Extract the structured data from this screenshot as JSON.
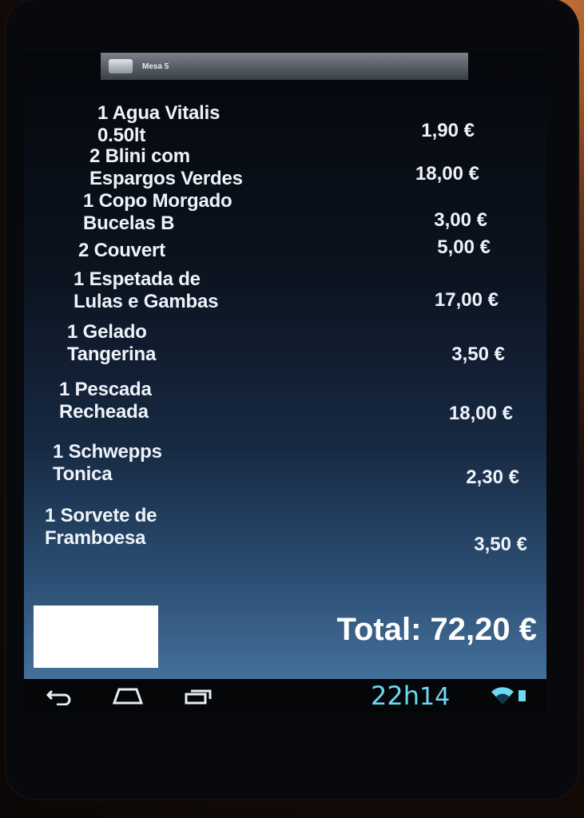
{
  "app": {
    "table_name": "Mesa 5"
  },
  "order_items": [
    {
      "name": "1 Agua Vitalis\n0.50lt",
      "price": "1,90 €"
    },
    {
      "name": "2 Blini com\nEspargos Verdes",
      "price": "18,00 €"
    },
    {
      "name": "1 Copo Morgado\nBucelas B",
      "price": "3,00 €"
    },
    {
      "name": "2 Couvert",
      "price": "5,00 €"
    },
    {
      "name": "1 Espetada de\nLulas e Gambas",
      "price": "17,00 €"
    },
    {
      "name": "1 Gelado\nTangerina",
      "price": "3,50 €"
    },
    {
      "name": "1 Pescada\nRecheada",
      "price": "18,00 €"
    },
    {
      "name": "1 Schwepps\nTonica",
      "price": "2,30 €"
    },
    {
      "name": "1 Sorvete de\nFramboesa",
      "price": "3,50 €"
    }
  ],
  "total_label": "Total: 72,20 €",
  "status_bar": {
    "time_hour": "22h",
    "time_minute": "14",
    "icons": [
      "wifi-icon",
      "battery-icon"
    ],
    "accent_color": "#6fd8f2"
  },
  "nav_bar": {
    "icons": [
      "back-icon",
      "home-icon",
      "recent-apps-icon"
    ]
  }
}
